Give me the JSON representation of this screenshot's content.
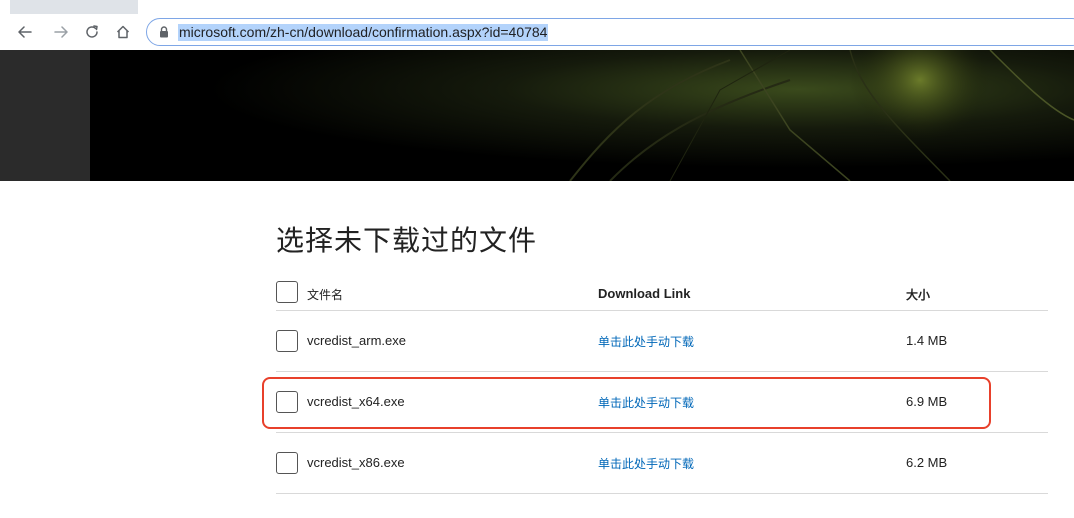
{
  "browser": {
    "url": "microsoft.com/zh-cn/download/confirmation.aspx?id=40784",
    "icons": {
      "back": "arrow-left-icon",
      "forward": "arrow-right-icon",
      "reload": "reload-icon",
      "home": "home-icon",
      "lock": "lock-icon"
    },
    "colors": {
      "url_selection": "#b3d3fb",
      "omnibox_border": "#7ea6e6"
    }
  },
  "page": {
    "heading": "选择未下载过的文件",
    "table": {
      "headers": {
        "name": "文件名",
        "link": "Download Link",
        "size": "大小"
      },
      "rows": [
        {
          "name": "vcredist_arm.exe",
          "link": "单击此处手动下载",
          "size": "1.4 MB",
          "checked": false,
          "highlighted": false
        },
        {
          "name": "vcredist_x64.exe",
          "link": "单击此处手动下载",
          "size": "6.9 MB",
          "checked": false,
          "highlighted": true
        },
        {
          "name": "vcredist_x86.exe",
          "link": "单击此处手动下载",
          "size": "6.2 MB",
          "checked": false,
          "highlighted": false
        }
      ]
    },
    "colors": {
      "link": "#0067b8",
      "highlight_annotation": "#e8402b",
      "divider": "#d9d9d9"
    }
  }
}
